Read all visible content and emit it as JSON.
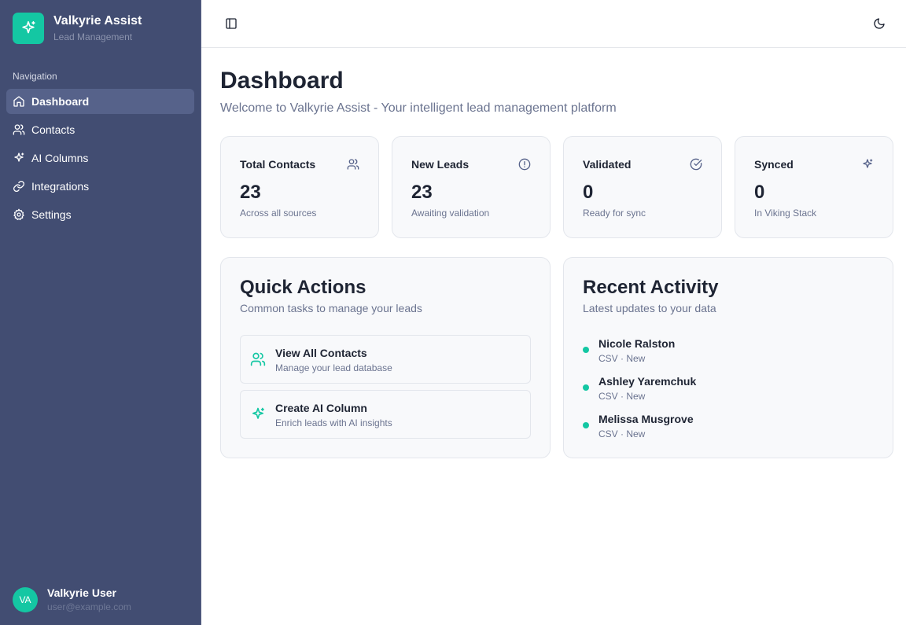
{
  "brand": {
    "name": "Valkyrie Assist",
    "subtitle": "Lead Management",
    "logo_icon": "sparkles-icon",
    "accent": "#14c7a3"
  },
  "sidebar": {
    "heading": "Navigation",
    "items": [
      {
        "label": "Dashboard",
        "icon": "home-icon",
        "active": true
      },
      {
        "label": "Contacts",
        "icon": "users-icon"
      },
      {
        "label": "AI Columns",
        "icon": "sparkles-icon"
      },
      {
        "label": "Integrations",
        "icon": "link-icon"
      },
      {
        "label": "Settings",
        "icon": "gear-icon"
      }
    ]
  },
  "user": {
    "initials": "VA",
    "name": "Valkyrie User",
    "email": "user@example.com"
  },
  "header": {
    "left_icon": "sidebar-toggle-icon",
    "right_icon": "moon-icon"
  },
  "page": {
    "title": "Dashboard",
    "subtitle": "Welcome to Valkyrie Assist - Your intelligent lead management platform"
  },
  "stats": [
    {
      "label": "Total Contacts",
      "value": "23",
      "note": "Across all sources",
      "icon": "users-icon"
    },
    {
      "label": "New Leads",
      "value": "23",
      "note": "Awaiting validation",
      "icon": "alert-circle-icon"
    },
    {
      "label": "Validated",
      "value": "0",
      "note": "Ready for sync",
      "icon": "check-circle-icon"
    },
    {
      "label": "Synced",
      "value": "0",
      "note": "In Viking Stack",
      "icon": "sparkles-icon"
    }
  ],
  "quick_actions": {
    "title": "Quick Actions",
    "subtitle": "Common tasks to manage your leads",
    "items": [
      {
        "title": "View All Contacts",
        "desc": "Manage your lead database",
        "icon": "users-icon"
      },
      {
        "title": "Create AI Column",
        "desc": "Enrich leads with AI insights",
        "icon": "sparkles-icon"
      }
    ]
  },
  "recent_activity": {
    "title": "Recent Activity",
    "subtitle": "Latest updates to your data",
    "items": [
      {
        "name": "Nicole Ralston",
        "meta": "CSV · New"
      },
      {
        "name": "Ashley Yaremchuk",
        "meta": "CSV · New"
      },
      {
        "name": "Melissa Musgrove",
        "meta": "CSV · New"
      }
    ]
  }
}
